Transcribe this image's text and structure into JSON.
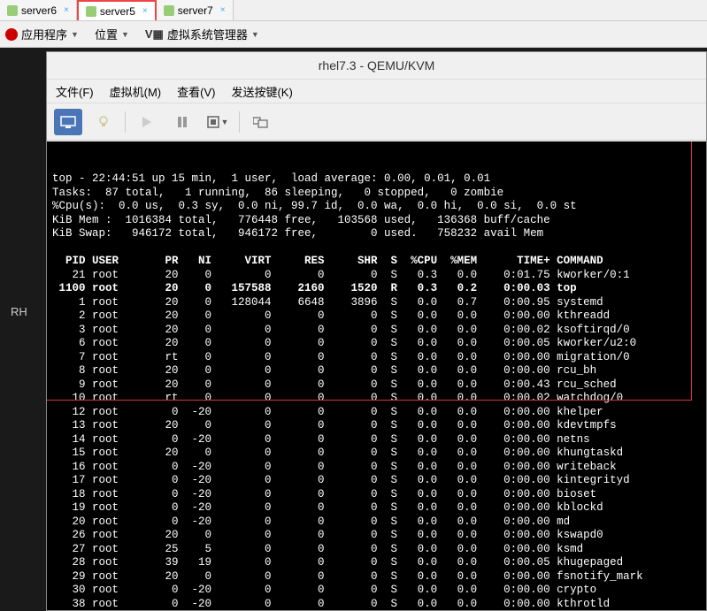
{
  "tabs": [
    {
      "label": "server6",
      "active": false
    },
    {
      "label": "server5",
      "active": true
    },
    {
      "label": "server7",
      "active": false
    }
  ],
  "appbar": {
    "apps": "应用程序",
    "location": "位置",
    "vmm": "虚拟系统管理器"
  },
  "rh_label": "RH",
  "vm": {
    "title": "rhel7.3 - QEMU/KVM",
    "menu": {
      "file": "文件(F)",
      "vm": "虚拟机(M)",
      "view": "查看(V)",
      "sendkey": "发送按键(K)"
    }
  },
  "top_header": {
    "line1": "top - 22:44:51 up 15 min,  1 user,  load average: 0.00, 0.01, 0.01",
    "line2": "Tasks:  87 total,   1 running,  86 sleeping,   0 stopped,   0 zombie",
    "line3": "%Cpu(s):  0.0 us,  0.3 sy,  0.0 ni, 99.7 id,  0.0 wa,  0.0 hi,  0.0 si,  0.0 st",
    "line4": "KiB Mem :  1016384 total,   776448 free,   103568 used,   136368 buff/cache",
    "line5": "KiB Swap:   946172 total,   946172 free,        0 used.   758232 avail Mem"
  },
  "columns": [
    "PID",
    "USER",
    "PR",
    "NI",
    "VIRT",
    "RES",
    "SHR",
    "S",
    "%CPU",
    "%MEM",
    "TIME+",
    "COMMAND"
  ],
  "rows": [
    {
      "pid": "21",
      "user": "root",
      "pr": "20",
      "ni": "0",
      "virt": "0",
      "res": "0",
      "shr": "0",
      "s": "S",
      "cpu": "0.3",
      "mem": "0.0",
      "time": "0:01.75",
      "cmd": "kworker/0:1",
      "hl": false
    },
    {
      "pid": "1100",
      "user": "root",
      "pr": "20",
      "ni": "0",
      "virt": "157588",
      "res": "2160",
      "shr": "1520",
      "s": "R",
      "cpu": "0.3",
      "mem": "0.2",
      "time": "0:00.03",
      "cmd": "top",
      "hl": true
    },
    {
      "pid": "1",
      "user": "root",
      "pr": "20",
      "ni": "0",
      "virt": "128044",
      "res": "6648",
      "shr": "3896",
      "s": "S",
      "cpu": "0.0",
      "mem": "0.7",
      "time": "0:00.95",
      "cmd": "systemd",
      "hl": false
    },
    {
      "pid": "2",
      "user": "root",
      "pr": "20",
      "ni": "0",
      "virt": "0",
      "res": "0",
      "shr": "0",
      "s": "S",
      "cpu": "0.0",
      "mem": "0.0",
      "time": "0:00.00",
      "cmd": "kthreadd",
      "hl": false
    },
    {
      "pid": "3",
      "user": "root",
      "pr": "20",
      "ni": "0",
      "virt": "0",
      "res": "0",
      "shr": "0",
      "s": "S",
      "cpu": "0.0",
      "mem": "0.0",
      "time": "0:00.02",
      "cmd": "ksoftirqd/0",
      "hl": false
    },
    {
      "pid": "6",
      "user": "root",
      "pr": "20",
      "ni": "0",
      "virt": "0",
      "res": "0",
      "shr": "0",
      "s": "S",
      "cpu": "0.0",
      "mem": "0.0",
      "time": "0:00.05",
      "cmd": "kworker/u2:0",
      "hl": false
    },
    {
      "pid": "7",
      "user": "root",
      "pr": "rt",
      "ni": "0",
      "virt": "0",
      "res": "0",
      "shr": "0",
      "s": "S",
      "cpu": "0.0",
      "mem": "0.0",
      "time": "0:00.00",
      "cmd": "migration/0",
      "hl": false
    },
    {
      "pid": "8",
      "user": "root",
      "pr": "20",
      "ni": "0",
      "virt": "0",
      "res": "0",
      "shr": "0",
      "s": "S",
      "cpu": "0.0",
      "mem": "0.0",
      "time": "0:00.00",
      "cmd": "rcu_bh",
      "hl": false
    },
    {
      "pid": "9",
      "user": "root",
      "pr": "20",
      "ni": "0",
      "virt": "0",
      "res": "0",
      "shr": "0",
      "s": "S",
      "cpu": "0.0",
      "mem": "0.0",
      "time": "0:00.43",
      "cmd": "rcu_sched",
      "hl": false
    },
    {
      "pid": "10",
      "user": "root",
      "pr": "rt",
      "ni": "0",
      "virt": "0",
      "res": "0",
      "shr": "0",
      "s": "S",
      "cpu": "0.0",
      "mem": "0.0",
      "time": "0:00.02",
      "cmd": "watchdog/0",
      "hl": false
    },
    {
      "pid": "12",
      "user": "root",
      "pr": "0",
      "ni": "-20",
      "virt": "0",
      "res": "0",
      "shr": "0",
      "s": "S",
      "cpu": "0.0",
      "mem": "0.0",
      "time": "0:00.00",
      "cmd": "khelper",
      "hl": false
    },
    {
      "pid": "13",
      "user": "root",
      "pr": "20",
      "ni": "0",
      "virt": "0",
      "res": "0",
      "shr": "0",
      "s": "S",
      "cpu": "0.0",
      "mem": "0.0",
      "time": "0:00.00",
      "cmd": "kdevtmpfs",
      "hl": false
    },
    {
      "pid": "14",
      "user": "root",
      "pr": "0",
      "ni": "-20",
      "virt": "0",
      "res": "0",
      "shr": "0",
      "s": "S",
      "cpu": "0.0",
      "mem": "0.0",
      "time": "0:00.00",
      "cmd": "netns",
      "hl": false
    },
    {
      "pid": "15",
      "user": "root",
      "pr": "20",
      "ni": "0",
      "virt": "0",
      "res": "0",
      "shr": "0",
      "s": "S",
      "cpu": "0.0",
      "mem": "0.0",
      "time": "0:00.00",
      "cmd": "khungtaskd",
      "hl": false
    },
    {
      "pid": "16",
      "user": "root",
      "pr": "0",
      "ni": "-20",
      "virt": "0",
      "res": "0",
      "shr": "0",
      "s": "S",
      "cpu": "0.0",
      "mem": "0.0",
      "time": "0:00.00",
      "cmd": "writeback",
      "hl": false
    },
    {
      "pid": "17",
      "user": "root",
      "pr": "0",
      "ni": "-20",
      "virt": "0",
      "res": "0",
      "shr": "0",
      "s": "S",
      "cpu": "0.0",
      "mem": "0.0",
      "time": "0:00.00",
      "cmd": "kintegrityd",
      "hl": false
    },
    {
      "pid": "18",
      "user": "root",
      "pr": "0",
      "ni": "-20",
      "virt": "0",
      "res": "0",
      "shr": "0",
      "s": "S",
      "cpu": "0.0",
      "mem": "0.0",
      "time": "0:00.00",
      "cmd": "bioset",
      "hl": false
    },
    {
      "pid": "19",
      "user": "root",
      "pr": "0",
      "ni": "-20",
      "virt": "0",
      "res": "0",
      "shr": "0",
      "s": "S",
      "cpu": "0.0",
      "mem": "0.0",
      "time": "0:00.00",
      "cmd": "kblockd",
      "hl": false
    },
    {
      "pid": "20",
      "user": "root",
      "pr": "0",
      "ni": "-20",
      "virt": "0",
      "res": "0",
      "shr": "0",
      "s": "S",
      "cpu": "0.0",
      "mem": "0.0",
      "time": "0:00.00",
      "cmd": "md",
      "hl": false
    },
    {
      "pid": "26",
      "user": "root",
      "pr": "20",
      "ni": "0",
      "virt": "0",
      "res": "0",
      "shr": "0",
      "s": "S",
      "cpu": "0.0",
      "mem": "0.0",
      "time": "0:00.00",
      "cmd": "kswapd0",
      "hl": false
    },
    {
      "pid": "27",
      "user": "root",
      "pr": "25",
      "ni": "5",
      "virt": "0",
      "res": "0",
      "shr": "0",
      "s": "S",
      "cpu": "0.0",
      "mem": "0.0",
      "time": "0:00.00",
      "cmd": "ksmd",
      "hl": false
    },
    {
      "pid": "28",
      "user": "root",
      "pr": "39",
      "ni": "19",
      "virt": "0",
      "res": "0",
      "shr": "0",
      "s": "S",
      "cpu": "0.0",
      "mem": "0.0",
      "time": "0:00.05",
      "cmd": "khugepaged",
      "hl": false
    },
    {
      "pid": "29",
      "user": "root",
      "pr": "20",
      "ni": "0",
      "virt": "0",
      "res": "0",
      "shr": "0",
      "s": "S",
      "cpu": "0.0",
      "mem": "0.0",
      "time": "0:00.00",
      "cmd": "fsnotify_mark",
      "hl": false
    },
    {
      "pid": "30",
      "user": "root",
      "pr": "0",
      "ni": "-20",
      "virt": "0",
      "res": "0",
      "shr": "0",
      "s": "S",
      "cpu": "0.0",
      "mem": "0.0",
      "time": "0:00.00",
      "cmd": "crypto",
      "hl": false
    },
    {
      "pid": "38",
      "user": "root",
      "pr": "0",
      "ni": "-20",
      "virt": "0",
      "res": "0",
      "shr": "0",
      "s": "S",
      "cpu": "0.0",
      "mem": "0.0",
      "time": "0:00.00",
      "cmd": "kthrotld",
      "hl": false
    }
  ]
}
